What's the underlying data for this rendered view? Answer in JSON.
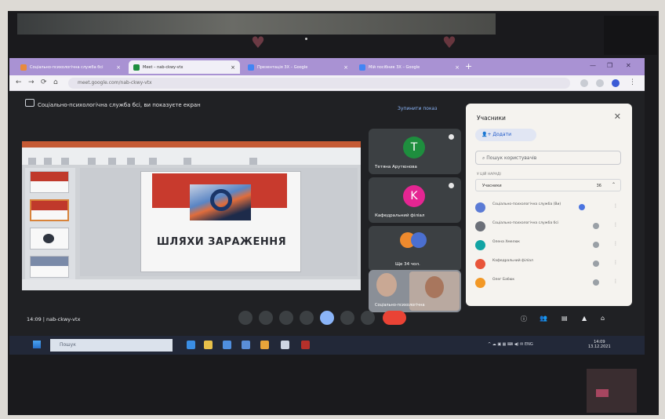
{
  "browser": {
    "tabs": [
      {
        "label": "Соціально-психологічна служба бсі",
        "color": "#e98a3d",
        "active": false
      },
      {
        "label": "Meet – nab-ckwy-vtx",
        "color": "#1e8e3e",
        "active": true
      },
      {
        "label": "Презентація ЗХ – Google",
        "color": "#4285f4",
        "active": false
      },
      {
        "label": "Мій посібник ЗХ – Google",
        "color": "#4285f4",
        "active": false
      }
    ],
    "url": "meet.google.com/nab-ckwy-vtx"
  },
  "meet": {
    "presenting_banner": "Соціально-психологічна служба бсі, ви показуєте екран",
    "stop_presenting": "Зупинити показ",
    "meeting_info": "14:09 | nab-ckwy-vtx"
  },
  "slide": {
    "title": "ШЛЯХИ ЗАРАЖЕННЯ"
  },
  "tiles": [
    {
      "initial": "T",
      "name": "Тетяна Арутюнова",
      "avatar_color": "#1e8e3e"
    },
    {
      "initial": "K",
      "name": "Кафедральний філіал",
      "avatar_color": "#e52592"
    },
    {
      "initial": "",
      "name": "Ще 34 чол.",
      "avatar_color": "#ee8a2d"
    },
    {
      "initial": "",
      "name": "Соціально-психологічна",
      "avatar_color": "#8a8f97"
    }
  ],
  "participants_panel": {
    "title": "Учасники",
    "add_label": "Додати",
    "search_placeholder": "Пошук користувачів",
    "section_label": "У ЦІЙ НАРАДІ",
    "group_label": "Учасники",
    "group_count": "36",
    "people": [
      {
        "name": "Соціально-психологічна служба (Ви)",
        "color": "#5b7bd5"
      },
      {
        "name": "Соціально-психологічна служба бсі",
        "color": "#6b6f78"
      },
      {
        "name": "Олена Хмелюк",
        "color": "#12a4a4"
      },
      {
        "name": "Кафедральний філіал",
        "color": "#e8553a"
      },
      {
        "name": "Олег Бабюк",
        "color": "#f29826"
      }
    ]
  },
  "taskbar": {
    "search_placeholder": "Пошук",
    "time": "14:09",
    "date": "13.12.2021"
  }
}
